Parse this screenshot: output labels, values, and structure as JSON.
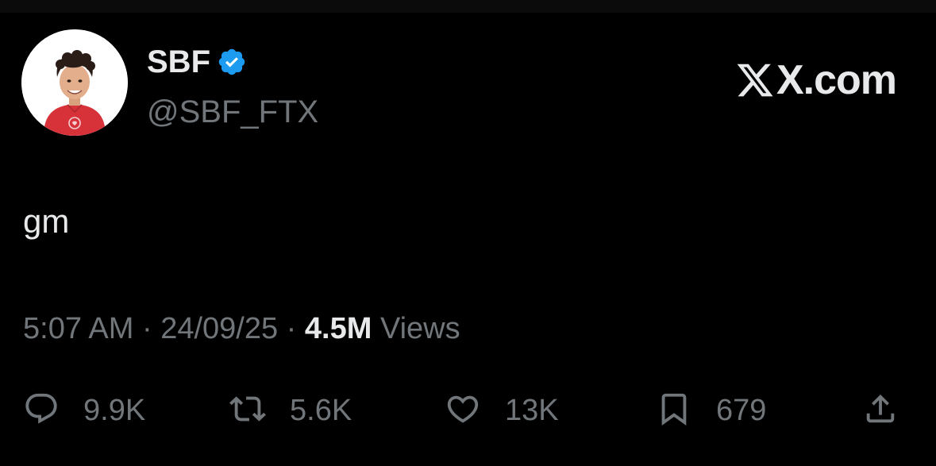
{
  "header": {
    "display_name": "SBF",
    "handle": "@SBF_FTX",
    "brand": "X.com"
  },
  "tweet": {
    "text": "gm"
  },
  "meta": {
    "time": "5:07 AM",
    "sep1": " · ",
    "date": "24/09/25",
    "sep2": " · ",
    "views_count": "4.5M",
    "views_label": " Views"
  },
  "actions": {
    "replies": "9.9K",
    "reposts": "5.6K",
    "likes": "13K",
    "bookmarks": "679"
  },
  "icons": {
    "verified": "verified-badge-icon",
    "brand": "x-logo-icon",
    "reply": "reply-icon",
    "repost": "repost-icon",
    "like": "heart-icon",
    "bookmark": "bookmark-icon",
    "share": "share-icon"
  },
  "colors": {
    "background": "#000000",
    "primary_text": "#e7e9ea",
    "secondary_text": "#71767b",
    "verified_blue": "#1d9bf0",
    "avatar_shirt": "#d7323a"
  }
}
